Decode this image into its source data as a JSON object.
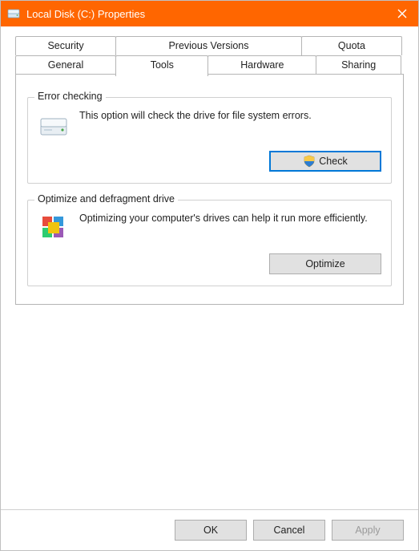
{
  "titlebar": {
    "title": "Local Disk (C:) Properties"
  },
  "tabs": {
    "row1": [
      {
        "label": "Security"
      },
      {
        "label": "Previous Versions"
      },
      {
        "label": "Quota"
      }
    ],
    "row2": [
      {
        "label": "General"
      },
      {
        "label": "Tools"
      },
      {
        "label": "Hardware"
      },
      {
        "label": "Sharing"
      }
    ]
  },
  "groups": {
    "error_checking": {
      "legend": "Error checking",
      "text": "This option will check the drive for file system errors.",
      "button": "Check"
    },
    "optimize": {
      "legend": "Optimize and defragment drive",
      "text": "Optimizing your computer's drives can help it run more efficiently.",
      "button": "Optimize"
    }
  },
  "footer": {
    "ok": "OK",
    "cancel": "Cancel",
    "apply": "Apply"
  }
}
